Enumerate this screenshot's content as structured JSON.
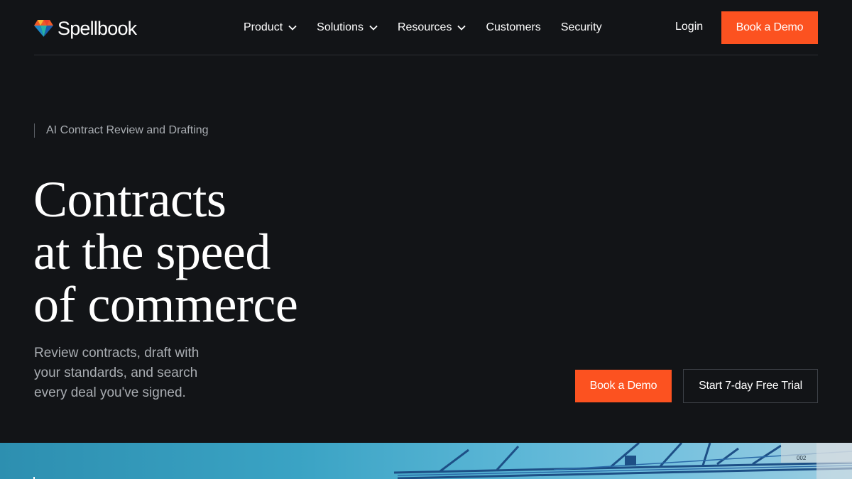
{
  "brand": {
    "name": "Spellbook",
    "logo_icon": "gem-icon",
    "colors": {
      "accent": "#fc5220",
      "background": "#121417"
    }
  },
  "nav": {
    "items": [
      {
        "label": "Product",
        "has_dropdown": true
      },
      {
        "label": "Solutions",
        "has_dropdown": true
      },
      {
        "label": "Resources",
        "has_dropdown": true
      },
      {
        "label": "Customers",
        "has_dropdown": false
      },
      {
        "label": "Security",
        "has_dropdown": false
      }
    ],
    "login_label": "Login",
    "cta_label": "Book a Demo"
  },
  "hero": {
    "eyebrow": "AI Contract Review and Drafting",
    "headline": [
      "Contracts",
      "at the speed",
      "of commerce"
    ],
    "subtext": "Review contracts, draft with your standards, and search every deal you've signed.",
    "primary_cta": "Book a Demo",
    "secondary_cta": "Start 7-day Free Trial"
  },
  "image": {
    "description_icon": "shipping-crane-photo",
    "visible_text": "002"
  }
}
